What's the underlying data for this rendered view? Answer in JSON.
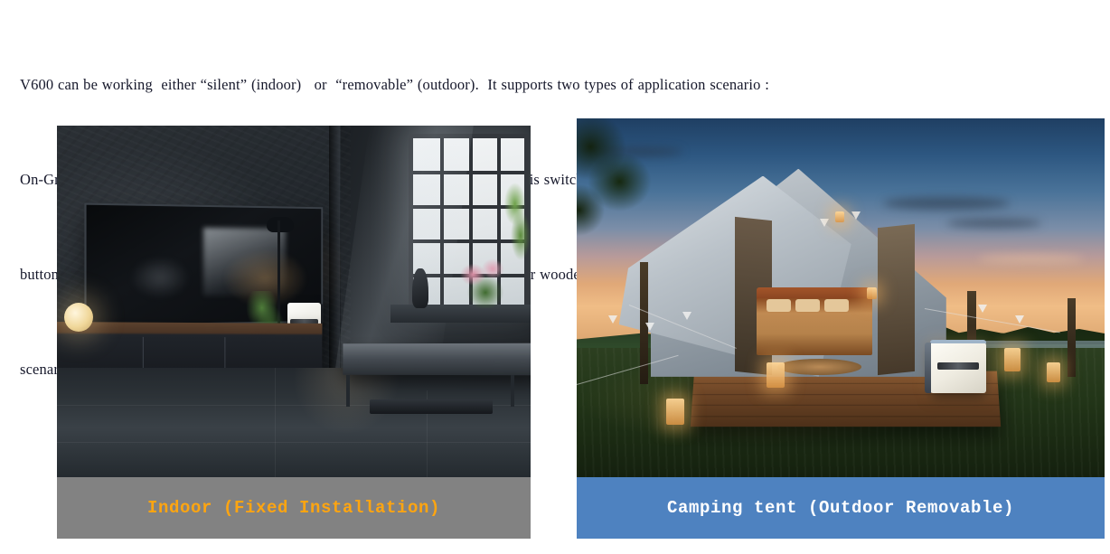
{
  "document": {
    "paragraph_lines": [
      "V600 can be working  either “silent” (indoor)   or  “removable” (outdoor).  It supports two types of application scenario :",
      "On-Grid and Off-Grid. Customer can switch these two  modes easily. We makes this switching on/off grid mode by touching the",
      "button. This mini power station  is applied  in balconies,  gardens,  homes,  outdoor wooden houses,  and other application",
      "scenarios."
    ]
  },
  "figures": [
    {
      "id": "indoor",
      "caption": "Indoor (Fixed Installation)",
      "caption_bg": "#828282",
      "caption_color": "#ffa510",
      "scene_description": "Dark industrial loft living room with wall-mounted flat-screen TV, long media console, floor lamp, potted plant, large grid window and a white wall-mounted V600 power station"
    },
    {
      "id": "outdoor",
      "caption": "Camping tent (Outdoor Removable)",
      "caption_bg": "#4e82c0",
      "caption_color": "#ffffff",
      "scene_description": "Glamping bell tent at dusk on a wooden deck with warm interior lighting, bed, lanterns, bunting flags and a portable V600 power station on the deck"
    }
  ]
}
